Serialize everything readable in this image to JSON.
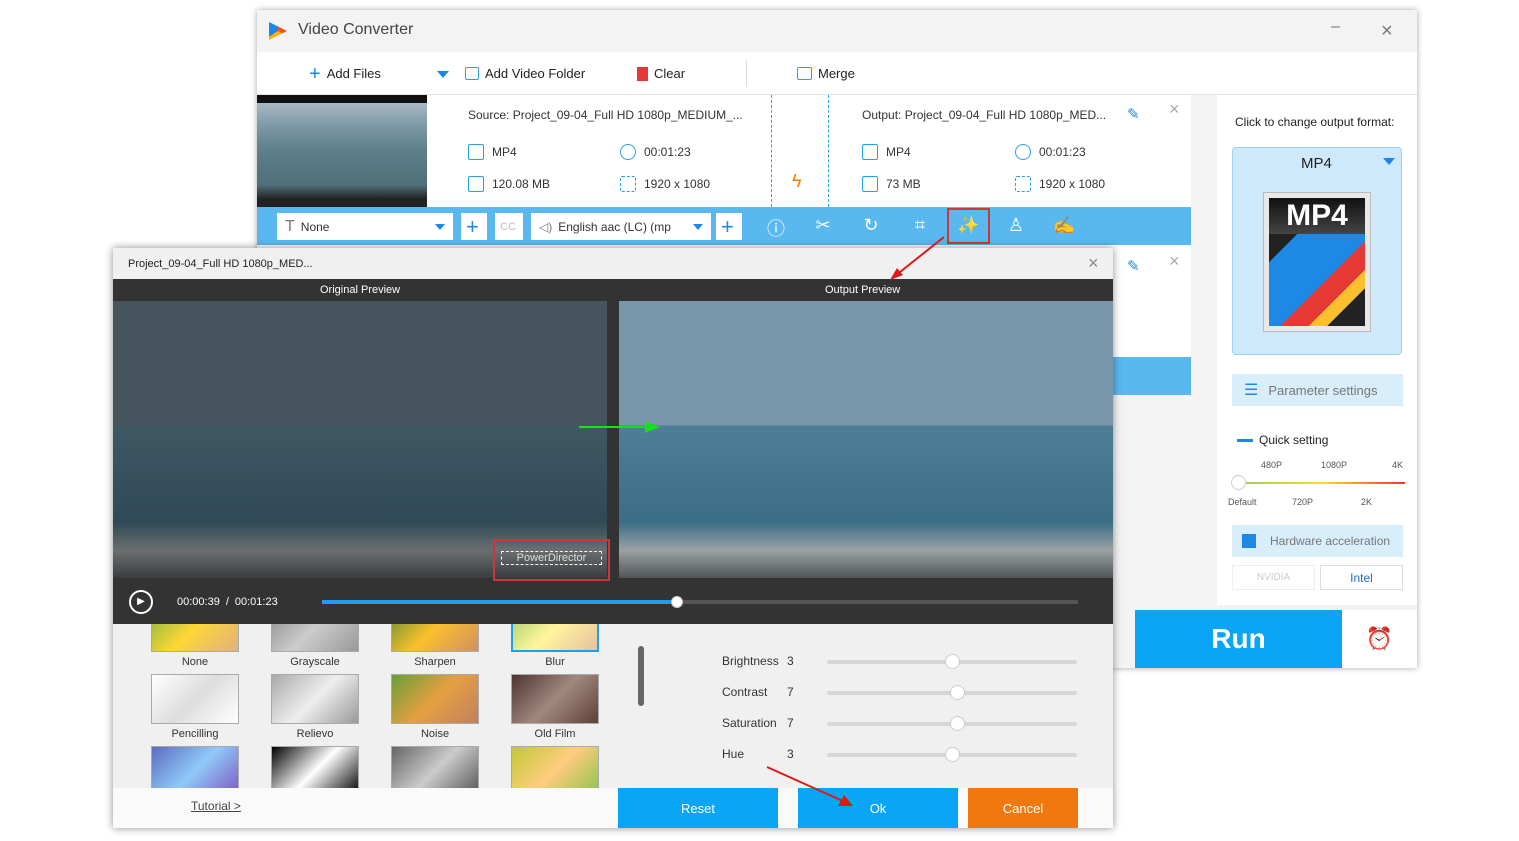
{
  "app": {
    "title": "Video Converter",
    "minimize": "–",
    "close": "×"
  },
  "toolbar": {
    "add_files": "Add Files",
    "add_folder": "Add Video Folder",
    "clear": "Clear",
    "merge": "Merge"
  },
  "file": {
    "source": "Source: Project_09-04_Full HD 1080p_MEDIUM_...",
    "output": "Output: Project_09-04_Full HD 1080p_MED...",
    "src_format": "MP4",
    "src_duration": "00:01:23",
    "src_size": "120.08 MB",
    "src_resolution": "1920 x 1080",
    "out_format": "MP4",
    "out_duration": "00:01:23",
    "out_size": "73 MB",
    "out_resolution": "1920 x 1080"
  },
  "edit_bar": {
    "subtitle": "None",
    "audio": "English aac (LC) (mp"
  },
  "right_panel": {
    "hint": "Click to change output format:",
    "format": "MP4",
    "format_badge": "MP4",
    "param": "Parameter settings",
    "quick": "Quick setting",
    "quality_top": [
      "480P",
      "1080P",
      "4K"
    ],
    "quality_bottom": [
      "Default",
      "720P",
      "2K"
    ],
    "quality_level": 0,
    "hw": "Hardware acceleration",
    "nvidia": "NVIDIA",
    "intel": "Intel"
  },
  "run": "Run",
  "dialog": {
    "title": "Project_09-04_Full HD 1080p_MED...",
    "close": "×",
    "original": "Original Preview",
    "output": "Output Preview",
    "watermark": "PowerDirector",
    "time_current": "00:00:39",
    "time_sep": "/",
    "time_total": "00:01:23",
    "progress": 0.47,
    "effects": [
      "None",
      "Grayscale",
      "Sharpen",
      "Blur",
      "Pencilling",
      "Relievo",
      "Noise",
      "Old Film"
    ],
    "selected_effect": "Blur",
    "adjust": [
      {
        "label": "Brightness",
        "value": "3",
        "pos": 0.5
      },
      {
        "label": "Contrast",
        "value": "7",
        "pos": 0.52
      },
      {
        "label": "Saturation",
        "value": "7",
        "pos": 0.52
      },
      {
        "label": "Hue",
        "value": "3",
        "pos": 0.5
      }
    ],
    "tutorial": "Tutorial >",
    "reset": "Reset",
    "ok": "Ok",
    "cancel": "Cancel"
  },
  "colors": {
    "accent": "#0aa5f5",
    "cancel": "#f0780f",
    "highlight": "#d0343c"
  }
}
